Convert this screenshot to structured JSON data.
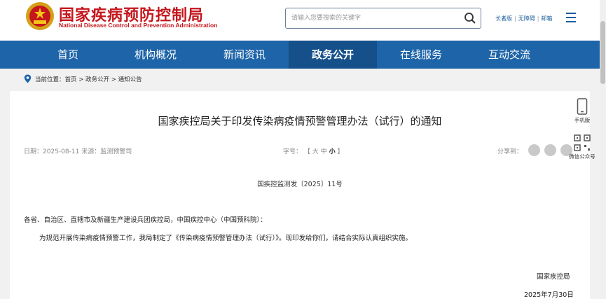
{
  "header": {
    "logo_cn": "国家疾病预防控制局",
    "logo_en": "National Disease Control and Prevention Administration",
    "search_placeholder": "请输入您要搜索的关键字",
    "links": [
      "长者版",
      "无障碍",
      "邮箱"
    ],
    "icons": {
      "search": "search-icon",
      "menu": "menu-icon",
      "emblem": "national-emblem-icon"
    }
  },
  "nav": {
    "items": [
      "首页",
      "机构概况",
      "新闻资讯",
      "政务公开",
      "在线服务",
      "互动交流"
    ],
    "active": "政务公开"
  },
  "breadcrumb": {
    "label": "当前位置：",
    "path": "首页 > 政务公开 > 通知公告"
  },
  "article": {
    "title": "国家疾控局关于印发传染病疫情预警管理办法（试行）的通知",
    "date_label": "日期：",
    "date": "2025-08-11",
    "source_label": "来源：",
    "source": "监测预警司",
    "fontsize_label": "字号：",
    "fontsize_open": "【",
    "fontsize_large": "大",
    "fontsize_medium": "中",
    "fontsize_small": "小",
    "fontsize_close": "】",
    "share_label": "分享到：",
    "doc_number": "国疾控监测发〔2025〕11号",
    "addressee": "各省、自治区、直辖市及新疆生产建设兵团疾控局，中国疾控中心（中国预科院）：",
    "paragraph": "为规范开展传染病疫情预警工作，我局制定了《传染病疫情预警管理办法（试行）》。现印发给你们，请结合实际认真组织实施。",
    "signer": "国家疾控局",
    "sign_date": "2025年7月30日"
  },
  "side": {
    "mobile_label": "手机版",
    "wechat_label": "微信公众号"
  },
  "colors": {
    "brand_red": "#c4161c",
    "nav_blue": "#1d64a9",
    "nav_active": "#15508a"
  }
}
